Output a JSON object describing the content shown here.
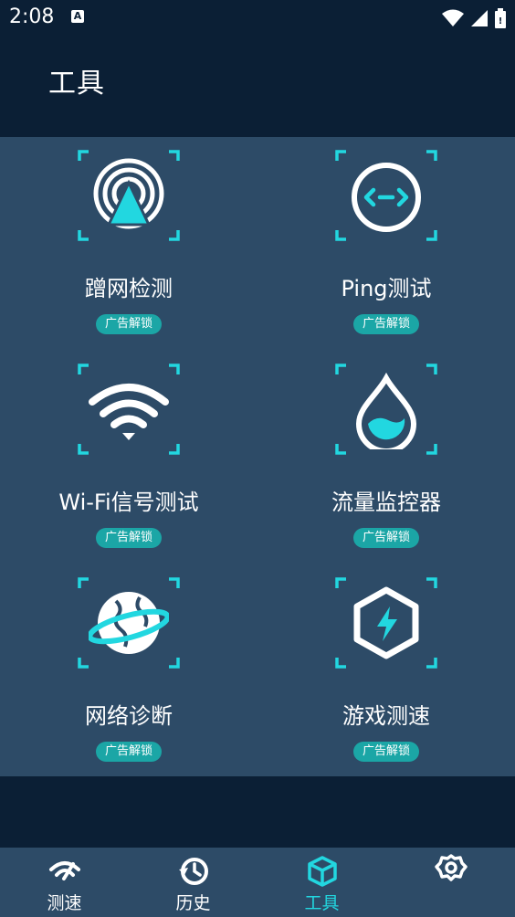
{
  "status": {
    "time": "2:08",
    "app_badge": "A"
  },
  "page": {
    "title": "工具"
  },
  "colors": {
    "accent": "#22d7e0",
    "panel": "#2d4b67",
    "background": "#0b1f35",
    "badge": "#1ba6a6"
  },
  "tools": [
    {
      "label": "蹭网检测",
      "badge": "广告解锁",
      "icon": "signal-tower-icon"
    },
    {
      "label": "Ping测试",
      "badge": "广告解锁",
      "icon": "code-circle-icon"
    },
    {
      "label": "Wi-Fi信号测试",
      "badge": "广告解锁",
      "icon": "wifi-icon"
    },
    {
      "label": "流量监控器",
      "badge": "广告解锁",
      "icon": "water-drop-icon"
    },
    {
      "label": "网络诊断",
      "badge": "广告解锁",
      "icon": "planet-icon"
    },
    {
      "label": "游戏测速",
      "badge": "广告解锁",
      "icon": "lightning-hexagon-icon"
    }
  ],
  "nav": [
    {
      "label": "测速",
      "icon": "speedometer-icon"
    },
    {
      "label": "历史",
      "icon": "history-icon"
    },
    {
      "label": "工具",
      "icon": "cube-icon",
      "active": true
    },
    {
      "label": "",
      "icon": "settings-icon"
    }
  ]
}
